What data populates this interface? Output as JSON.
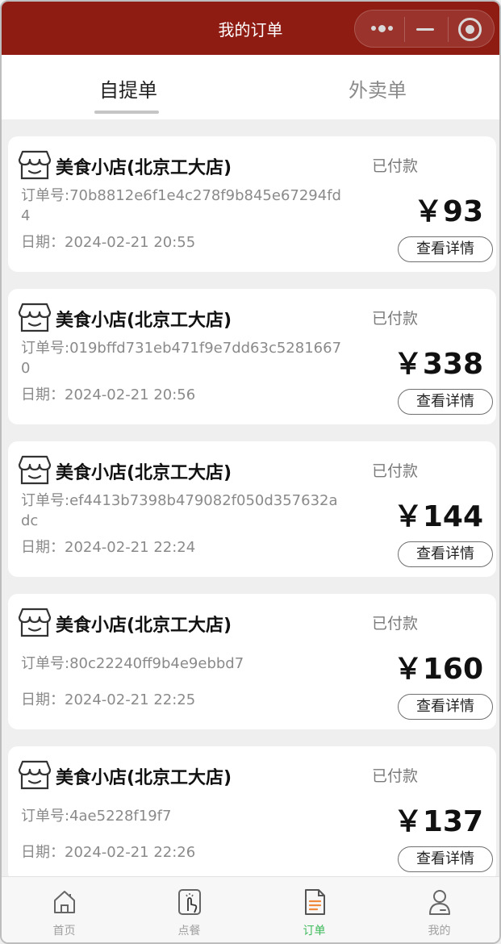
{
  "header": {
    "title": "我的订单"
  },
  "tabs": [
    {
      "label": "自提单",
      "active": true
    },
    {
      "label": "外卖单",
      "active": false
    }
  ],
  "orders": [
    {
      "shop": "美食小店(北京工大店)",
      "status": "已付款",
      "order_no": "订单号:70b8812e6f1e4c278f9b845e67294fd4",
      "date": "日期：2024-02-21 20:55",
      "price": "￥93",
      "detail_label": "查看详情"
    },
    {
      "shop": "美食小店(北京工大店)",
      "status": "已付款",
      "order_no": "订单号:019bffd731eb471f9e7dd63c52816670",
      "date": "日期：2024-02-21 20:56",
      "price": "￥338",
      "detail_label": "查看详情"
    },
    {
      "shop": "美食小店(北京工大店)",
      "status": "已付款",
      "order_no": "订单号:ef4413b7398b479082f050d357632adc",
      "date": "日期：2024-02-21 22:24",
      "price": "￥144",
      "detail_label": "查看详情"
    },
    {
      "shop": "美食小店(北京工大店)",
      "status": "已付款",
      "order_no": "订单号:80c22240ff9b4e9ebbd7",
      "date": "日期：2024-02-21 22:25",
      "price": "￥160",
      "detail_label": "查看详情"
    },
    {
      "shop": "美食小店(北京工大店)",
      "status": "已付款",
      "order_no": "订单号:4ae5228f19f7",
      "date": "日期：2024-02-21 22:26",
      "price": "￥137",
      "detail_label": "查看详情"
    }
  ],
  "nav": [
    {
      "label": "首页",
      "icon": "home-icon",
      "active": false
    },
    {
      "label": "点餐",
      "icon": "tap-order-icon",
      "active": false
    },
    {
      "label": "订单",
      "icon": "order-document-icon",
      "active": true
    },
    {
      "label": "我的",
      "icon": "profile-icon",
      "active": false
    }
  ],
  "colors": {
    "header_bg": "#8e1c13",
    "active_nav": "#3cba5a",
    "order_icon_accent": "#f08a3c"
  }
}
